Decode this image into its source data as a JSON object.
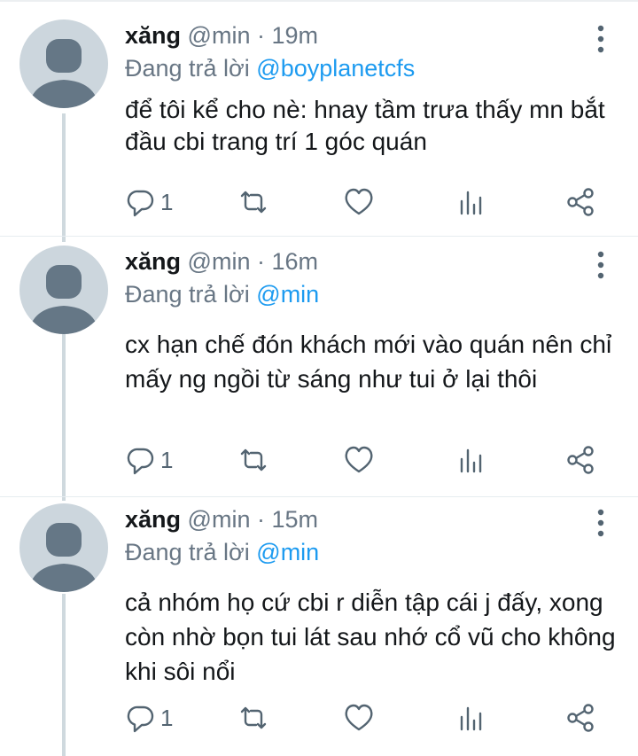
{
  "tweets": [
    {
      "name": "xăng",
      "handle": "@min",
      "separator": "·",
      "time": "19m",
      "replying_prefix": "Đang trả lời",
      "replying_to": "@boyplanetcfs",
      "text": "để tôi kể cho nè: hnay tầm trưa thấy mn bắt đầu cbi trang trí 1 góc quán",
      "reply_count": "1"
    },
    {
      "name": "xăng",
      "handle": "@min",
      "separator": "·",
      "time": "16m",
      "replying_prefix": "Đang trả lời",
      "replying_to": "@min",
      "text": "cx hạn chế đón khách mới vào quán nên chỉ mấy ng ngồi từ sáng như tui ở lại thôi",
      "reply_count": "1"
    },
    {
      "name": "xăng",
      "handle": "@min",
      "separator": "·",
      "time": "15m",
      "replying_prefix": "Đang trả lời",
      "replying_to": "@min",
      "text": "cả nhóm họ cứ cbi r diễn tập cái j đấy, xong còn nhờ bọn tui lát sau nhớ cổ vũ cho không khi sôi nổi",
      "reply_count": "1"
    }
  ],
  "icons": {
    "reply": "reply-icon",
    "retweet": "retweet-icon",
    "like": "heart-icon",
    "views": "views-chart-icon",
    "share": "share-icon",
    "more": "more-vertical-icon"
  },
  "colors": {
    "mention": "#1d9bf0",
    "secondary": "#687684",
    "icon": "#536471",
    "avatar_bg": "#ccd6dd",
    "avatar_fg": "#657786"
  }
}
